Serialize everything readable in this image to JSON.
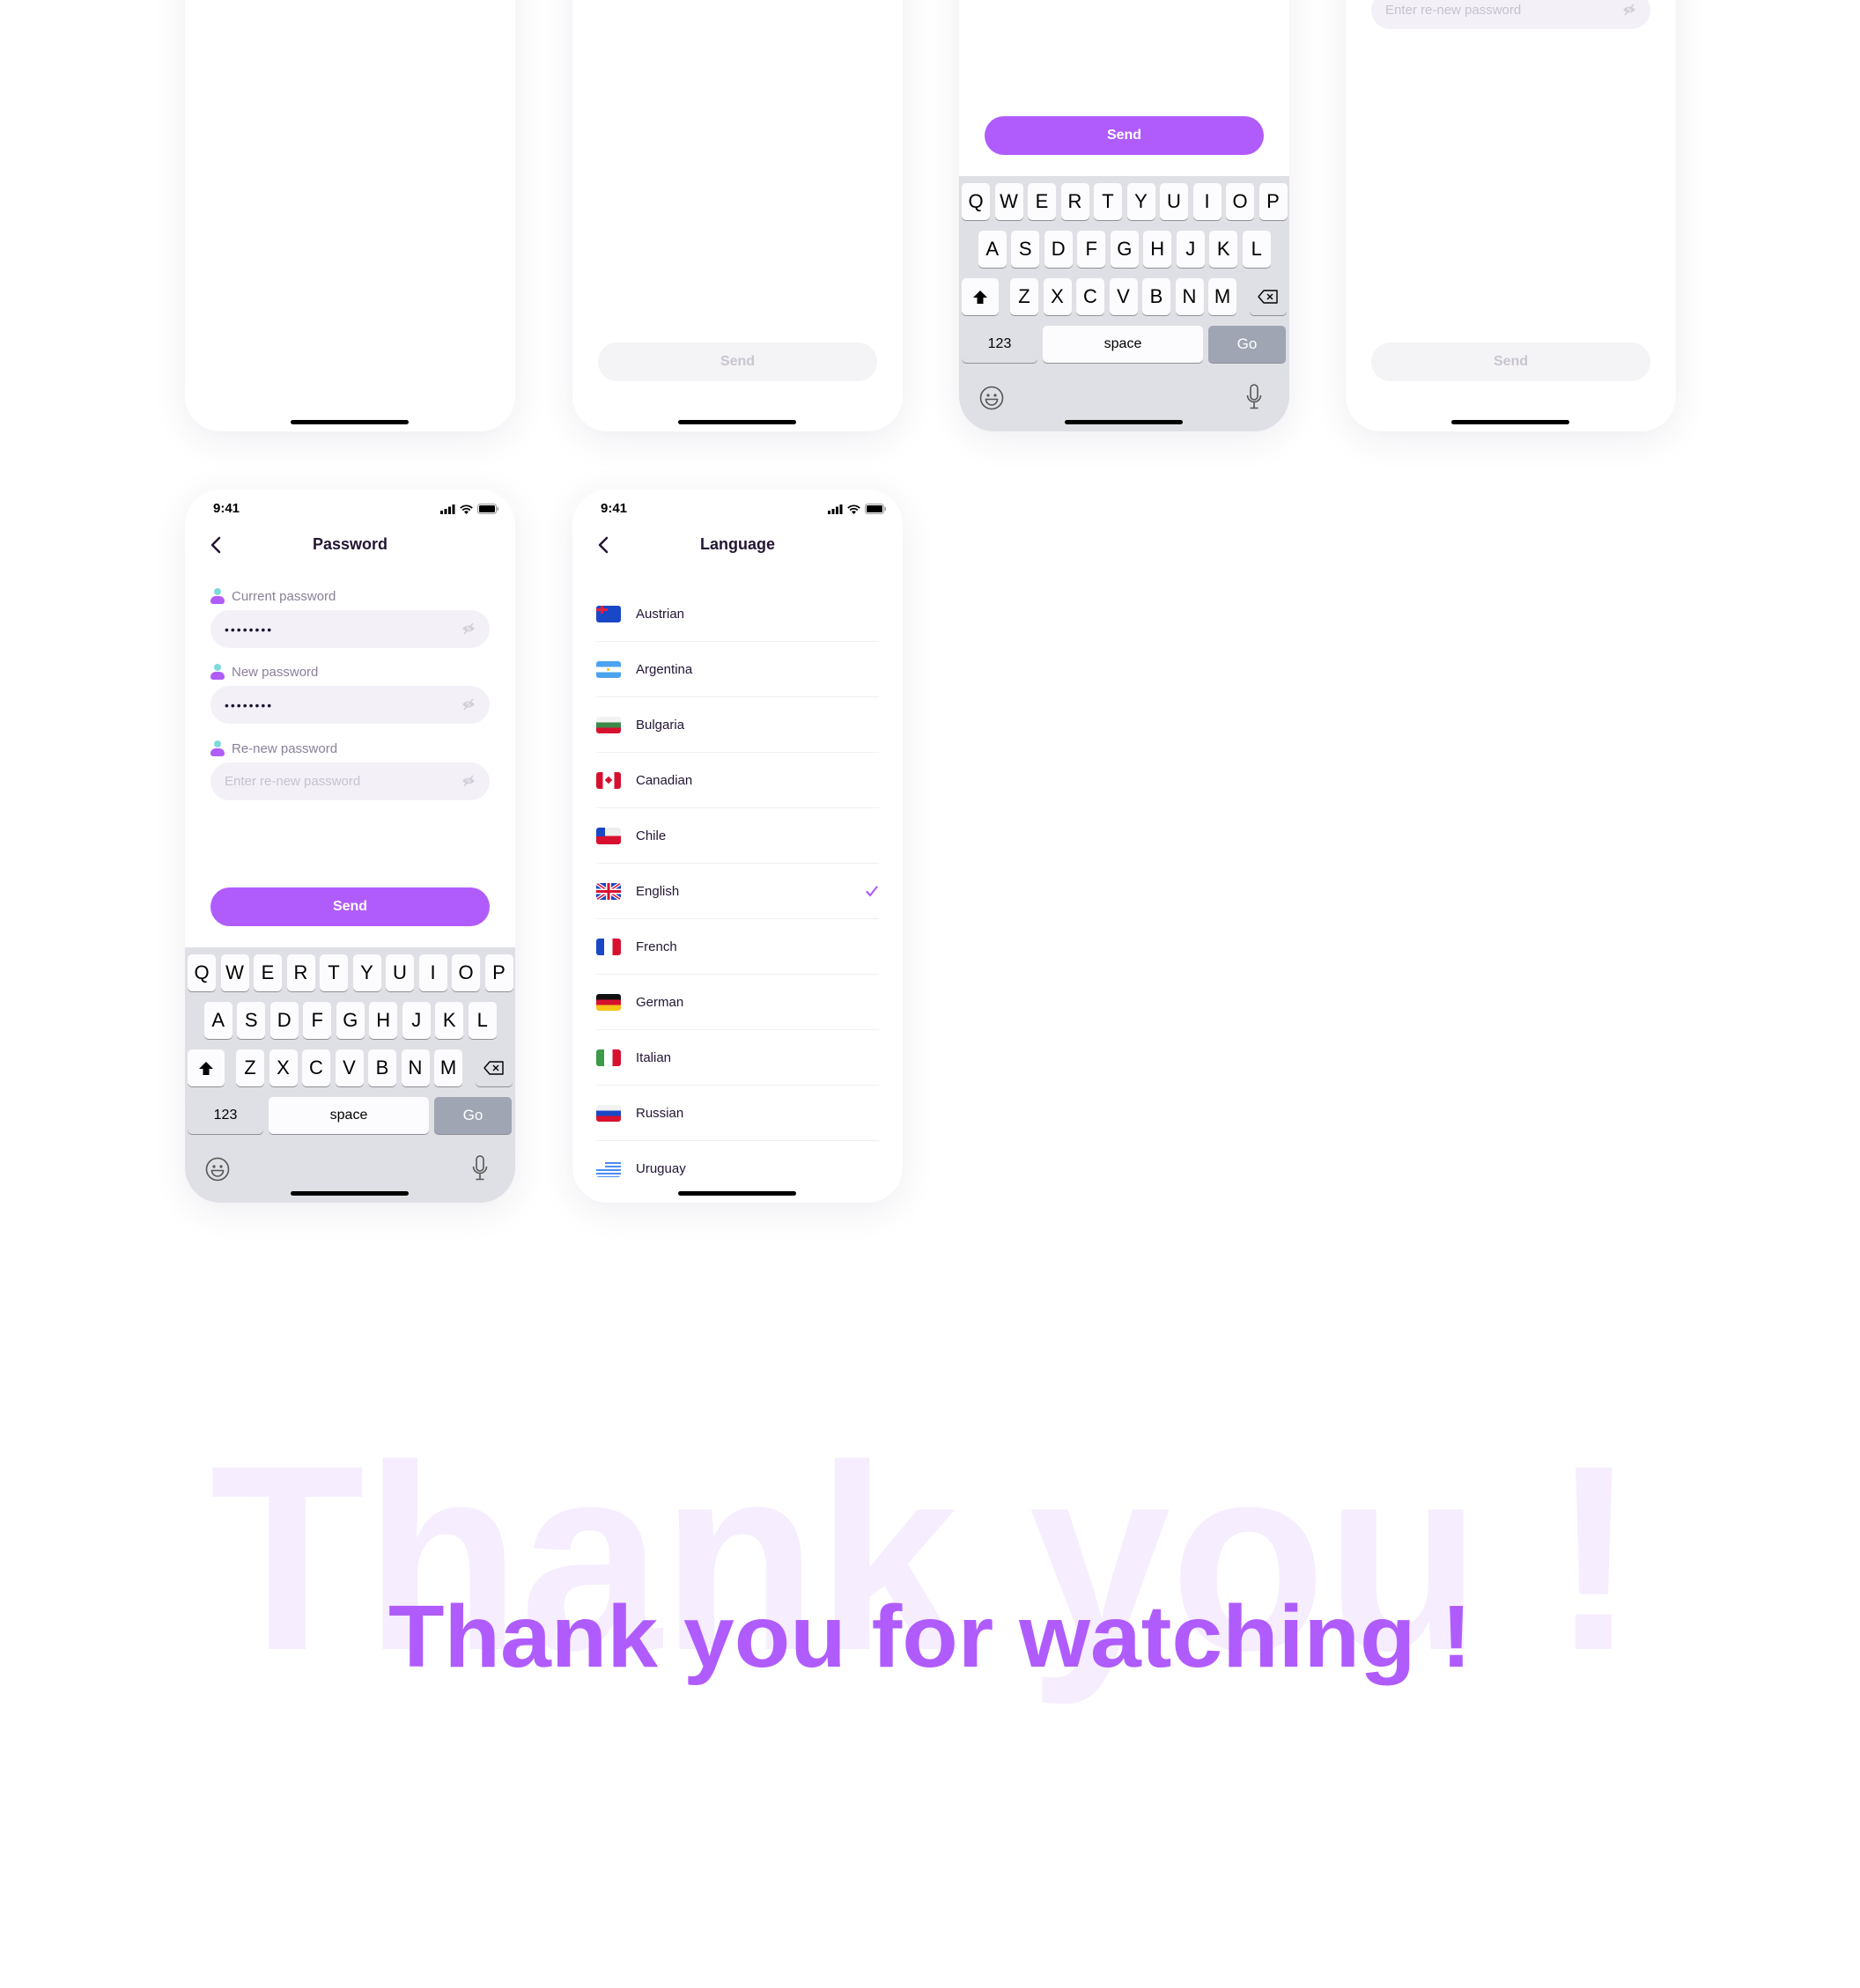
{
  "status_bar": {
    "time": "9:41"
  },
  "colors": {
    "accent": "#b05cfd",
    "watermark": "#f6edfe",
    "text_dark": "#231534"
  },
  "top_row": {
    "card2": {
      "send_label": "Send"
    },
    "card3": {
      "send_label": "Send"
    },
    "card4": {
      "renew_placeholder": "Enter re-new password",
      "send_label": "Send"
    }
  },
  "password_screen": {
    "title": "Password",
    "fields": [
      {
        "label": "Current password",
        "value": "••••••••",
        "placeholder": ""
      },
      {
        "label": "New password",
        "value": "••••••••",
        "placeholder": ""
      },
      {
        "label": "Re-new password",
        "value": "",
        "placeholder": "Enter re-new password"
      }
    ],
    "send_label": "Send"
  },
  "keyboard": {
    "row1": [
      "Q",
      "W",
      "E",
      "R",
      "T",
      "Y",
      "U",
      "I",
      "O",
      "P"
    ],
    "row2": [
      "A",
      "S",
      "D",
      "F",
      "G",
      "H",
      "J",
      "K",
      "L"
    ],
    "row3": [
      "Z",
      "X",
      "C",
      "V",
      "B",
      "N",
      "M"
    ],
    "numbers_label": "123",
    "space_label": "space",
    "go_label": "Go",
    "icons": [
      "shift-icon",
      "delete-icon",
      "emoji-icon",
      "microphone-icon"
    ]
  },
  "language_screen": {
    "title": "Language",
    "selected": "English",
    "items": [
      {
        "label": "Austrian",
        "flag": "australia-flag-icon"
      },
      {
        "label": "Argentina",
        "flag": "argentina-flag-icon"
      },
      {
        "label": "Bulgaria",
        "flag": "bulgaria-flag-icon"
      },
      {
        "label": "Canadian",
        "flag": "canada-flag-icon"
      },
      {
        "label": "Chile",
        "flag": "chile-flag-icon"
      },
      {
        "label": "English",
        "flag": "uk-flag-icon"
      },
      {
        "label": "French",
        "flag": "france-flag-icon"
      },
      {
        "label": "German",
        "flag": "germany-flag-icon"
      },
      {
        "label": "Italian",
        "flag": "italy-flag-icon"
      },
      {
        "label": "Russian",
        "flag": "russia-flag-icon"
      },
      {
        "label": "Uruguay",
        "flag": "uruguay-flag-icon"
      }
    ]
  },
  "closing": {
    "watermark": "Thank you !",
    "headline": "Thank you for watching !"
  }
}
